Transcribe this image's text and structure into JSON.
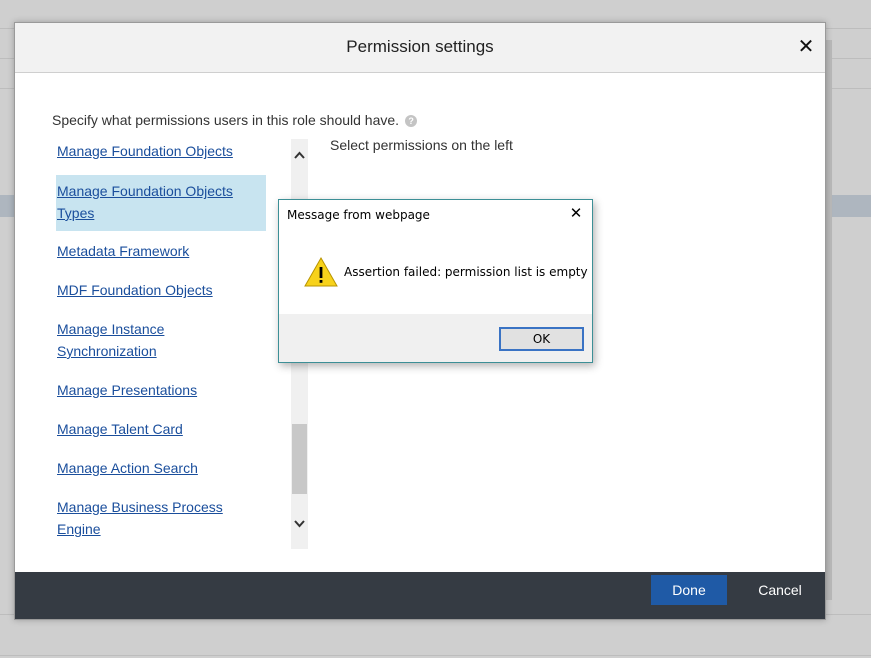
{
  "modal": {
    "title": "Permission settings",
    "close_glyph": "✕",
    "instruction": "Specify what permissions users in this role should have.",
    "help_glyph": "?",
    "right_hint": "Select permissions on the left",
    "items": [
      {
        "label": "Manage Foundation Objects"
      },
      {
        "label": "Manage Foundation Objects Types"
      },
      {
        "label": "Metadata Framework"
      },
      {
        "label": "MDF Foundation Objects"
      },
      {
        "label": "Manage Instance Synchronization"
      },
      {
        "label": "Manage Presentations"
      },
      {
        "label": "Manage Talent Card"
      },
      {
        "label": "Manage Action Search"
      },
      {
        "label": "Manage Business Process Engine"
      }
    ],
    "selected_index": 1,
    "scroll_up_glyph": "^",
    "scroll_down_glyph": "v",
    "done_label": "Done",
    "cancel_label": "Cancel"
  },
  "dialog": {
    "title": "Message from webpage",
    "close_glyph": "✕",
    "message": "Assertion failed: permission list is empty",
    "icon": "warning-icon",
    "ok_label": "OK"
  },
  "colors": {
    "accent": "#1f5aa6",
    "link": "#1a4e9c",
    "selected_bg": "#c8e4f0",
    "footer_bg": "#353b43"
  }
}
